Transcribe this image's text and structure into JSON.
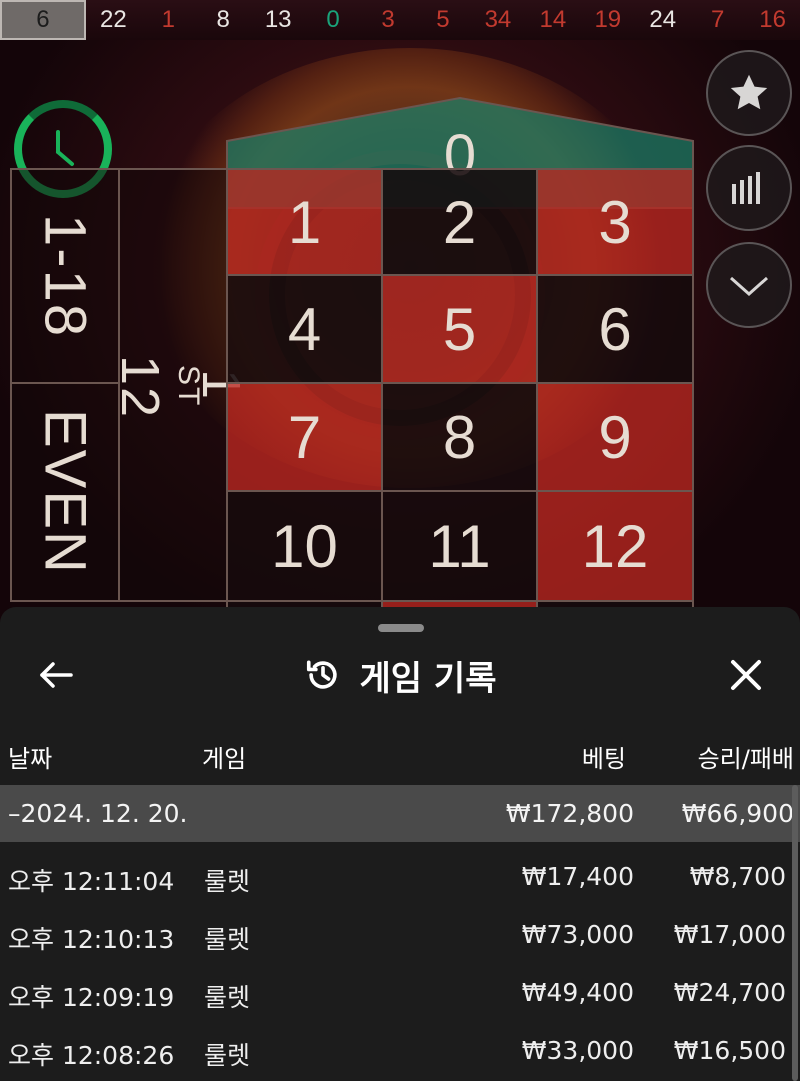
{
  "results": [
    {
      "v": "6",
      "c": "current"
    },
    {
      "v": "22",
      "c": "black"
    },
    {
      "v": "1",
      "c": "red"
    },
    {
      "v": "8",
      "c": "black"
    },
    {
      "v": "13",
      "c": "black"
    },
    {
      "v": "0",
      "c": "green"
    },
    {
      "v": "3",
      "c": "red"
    },
    {
      "v": "5",
      "c": "red"
    },
    {
      "v": "34",
      "c": "red"
    },
    {
      "v": "14",
      "c": "red"
    },
    {
      "v": "19",
      "c": "red"
    },
    {
      "v": "24",
      "c": "black"
    },
    {
      "v": "7",
      "c": "red"
    },
    {
      "v": "16",
      "c": "red"
    }
  ],
  "table": {
    "zero": "0",
    "low": "1-18",
    "even": "EVEN",
    "dozen_main": "1",
    "dozen_sup": "ST",
    "dozen_num": "12",
    "numbers": [
      {
        "n": "1",
        "color": "red"
      },
      {
        "n": "2",
        "color": "black"
      },
      {
        "n": "3",
        "color": "red"
      },
      {
        "n": "4",
        "color": "black"
      },
      {
        "n": "5",
        "color": "red"
      },
      {
        "n": "6",
        "color": "black"
      },
      {
        "n": "7",
        "color": "red"
      },
      {
        "n": "8",
        "color": "black"
      },
      {
        "n": "9",
        "color": "red"
      },
      {
        "n": "10",
        "color": "black"
      },
      {
        "n": "11",
        "color": "black"
      },
      {
        "n": "12",
        "color": "red"
      }
    ]
  },
  "icons": {
    "timer": "clock-icon",
    "favorite": "star-icon",
    "stats": "bar-chart-icon",
    "collapse": "chevron-down-icon",
    "back": "arrow-left-icon",
    "history": "history-icon",
    "close": "close-icon"
  },
  "colors": {
    "red": "#c23a2f",
    "green": "#1aa37a",
    "timer": "#19b35a",
    "sheet_bg": "#1c1c1c",
    "group_bg": "#4a4a4a"
  },
  "sheet": {
    "title": "게임 기록",
    "headers": {
      "date": "날짜",
      "game": "게임",
      "bet": "베팅",
      "winloss": "승리/패배"
    },
    "group": {
      "date": "–2024. 12. 20.",
      "bet": "₩172,800",
      "winloss": "₩66,900"
    },
    "rows": [
      {
        "time": "오후 12:11:04",
        "game": "룰렛",
        "bet": "₩17,400",
        "winloss": "₩8,700"
      },
      {
        "time": "오후 12:10:13",
        "game": "룰렛",
        "bet": "₩73,000",
        "winloss": "₩17,000"
      },
      {
        "time": "오후 12:09:19",
        "game": "룰렛",
        "bet": "₩49,400",
        "winloss": "₩24,700"
      },
      {
        "time": "오후 12:08:26",
        "game": "룰렛",
        "bet": "₩33,000",
        "winloss": "₩16,500"
      }
    ]
  }
}
